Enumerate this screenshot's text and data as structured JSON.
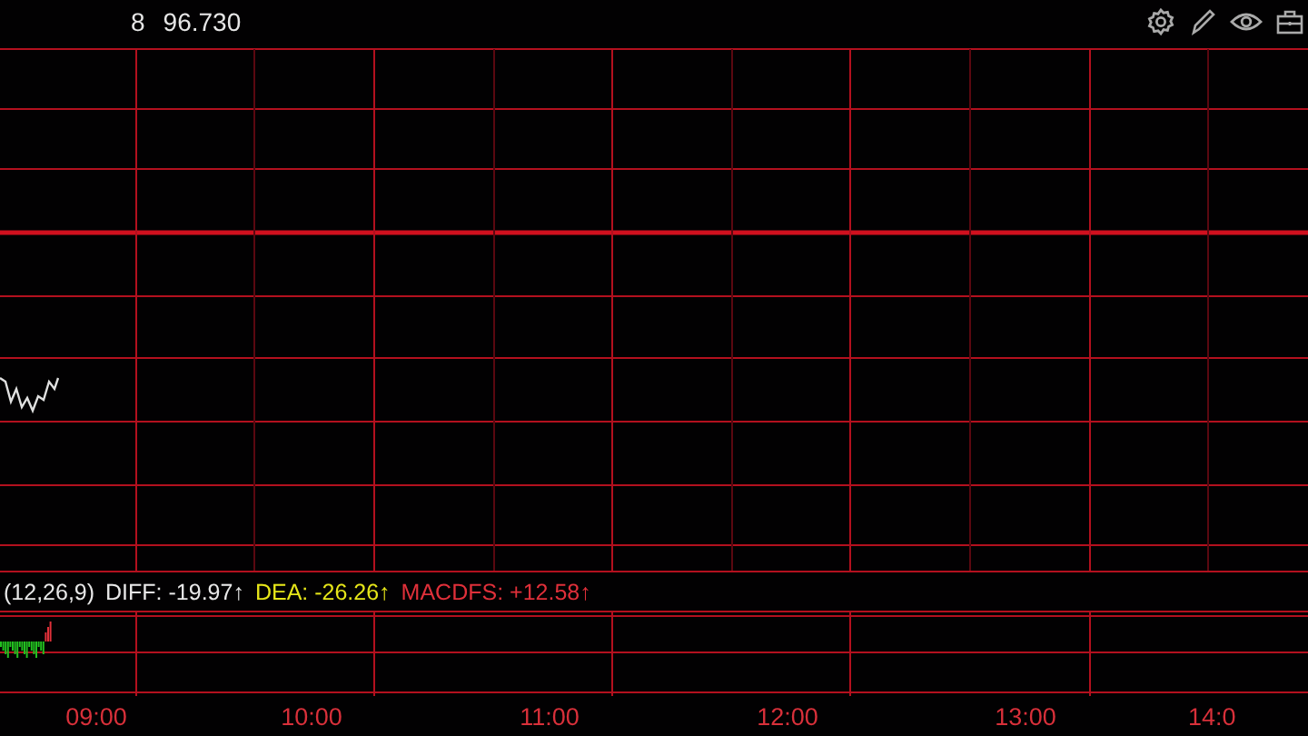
{
  "header": {
    "price_parts": [
      "8",
      "96.730"
    ]
  },
  "macd_legend": [
    {
      "text": "(12,26,9)",
      "color": "#e8e8e8"
    },
    {
      "text": "DIFF: -19.97↑",
      "color": "#e8e8e8"
    },
    {
      "text": "DEA: -26.26↑",
      "color": "#e6e619"
    },
    {
      "text": "MACDFS: +12.58↑",
      "color": "#e0303a"
    }
  ],
  "time_axis": [
    "09:00",
    "10:00",
    "11:00",
    "12:00",
    "13:00",
    "14:0"
  ]
}
